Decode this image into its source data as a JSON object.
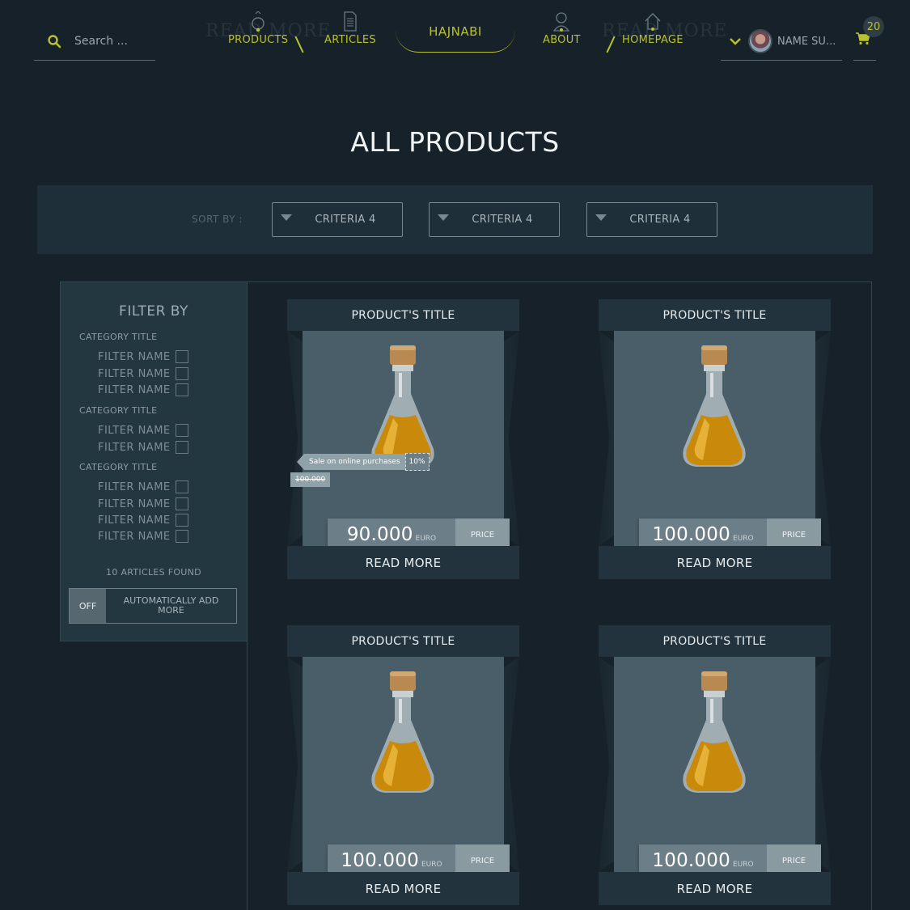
{
  "search": {
    "placeholder": "Search ..."
  },
  "nav": {
    "ghost_left": "READ MORE",
    "ghost_right": "READ MORE",
    "products": "PRODUCTS",
    "articles": "ARTICLES",
    "brand": "HAJNABI",
    "about": "ABOUT",
    "homepage": "HOMEPAGE"
  },
  "user": {
    "name": "NAME SU..."
  },
  "cart": {
    "count": "20"
  },
  "page_title": "ALL PRODUCTS",
  "sort": {
    "label": "SORT BY :",
    "options": [
      "CRITERIA 4",
      "CRITERIA 4",
      "CRITERIA 4"
    ]
  },
  "filter": {
    "title": "FILTER BY",
    "categories": [
      {
        "title": "CATEGORY TITLE",
        "items": [
          "FILTER NAME",
          "FILTER NAME",
          "FILTER NAME"
        ]
      },
      {
        "title": "CATEGORY TITLE",
        "items": [
          "FILTER NAME",
          "FILTER NAME"
        ]
      },
      {
        "title": "CATEGORY TITLE",
        "items": [
          "FILTER NAME",
          "FILTER NAME",
          "FILTER NAME",
          "FILTER NAME"
        ]
      }
    ],
    "found": "10 ARTICLES FOUND",
    "toggle_state": "OFF",
    "toggle_label": "AUTOMATICALLY ADD MORE"
  },
  "products": [
    {
      "title": "PRODUCT'S TITLE",
      "price": "90.000",
      "currency": "EURO",
      "price_button": "PRICE",
      "read_more": "READ MORE",
      "sale": {
        "text": "Sale on online purchases",
        "percent": "10%",
        "old_price": "100.000"
      }
    },
    {
      "title": "PRODUCT'S TITLE",
      "price": "100.000",
      "currency": "EURO",
      "price_button": "PRICE",
      "read_more": "READ MORE"
    },
    {
      "title": "PRODUCT'S TITLE",
      "price": "100.000",
      "currency": "EURO",
      "price_button": "PRICE",
      "read_more": "READ MORE"
    },
    {
      "title": "PRODUCT'S TITLE",
      "price": "100.000",
      "currency": "EURO",
      "price_button": "PRICE",
      "read_more": "READ MORE"
    }
  ],
  "icons": {
    "search": "search-icon",
    "products": "ring-icon",
    "articles": "document-icon",
    "about": "user-icon",
    "homepage": "home-icon",
    "dropdown": "chevron-down-icon",
    "cart": "cart-icon"
  },
  "colors": {
    "background": "#172129",
    "accent": "#b9c12e",
    "panel": "#233741",
    "card": "#4a5e69"
  }
}
